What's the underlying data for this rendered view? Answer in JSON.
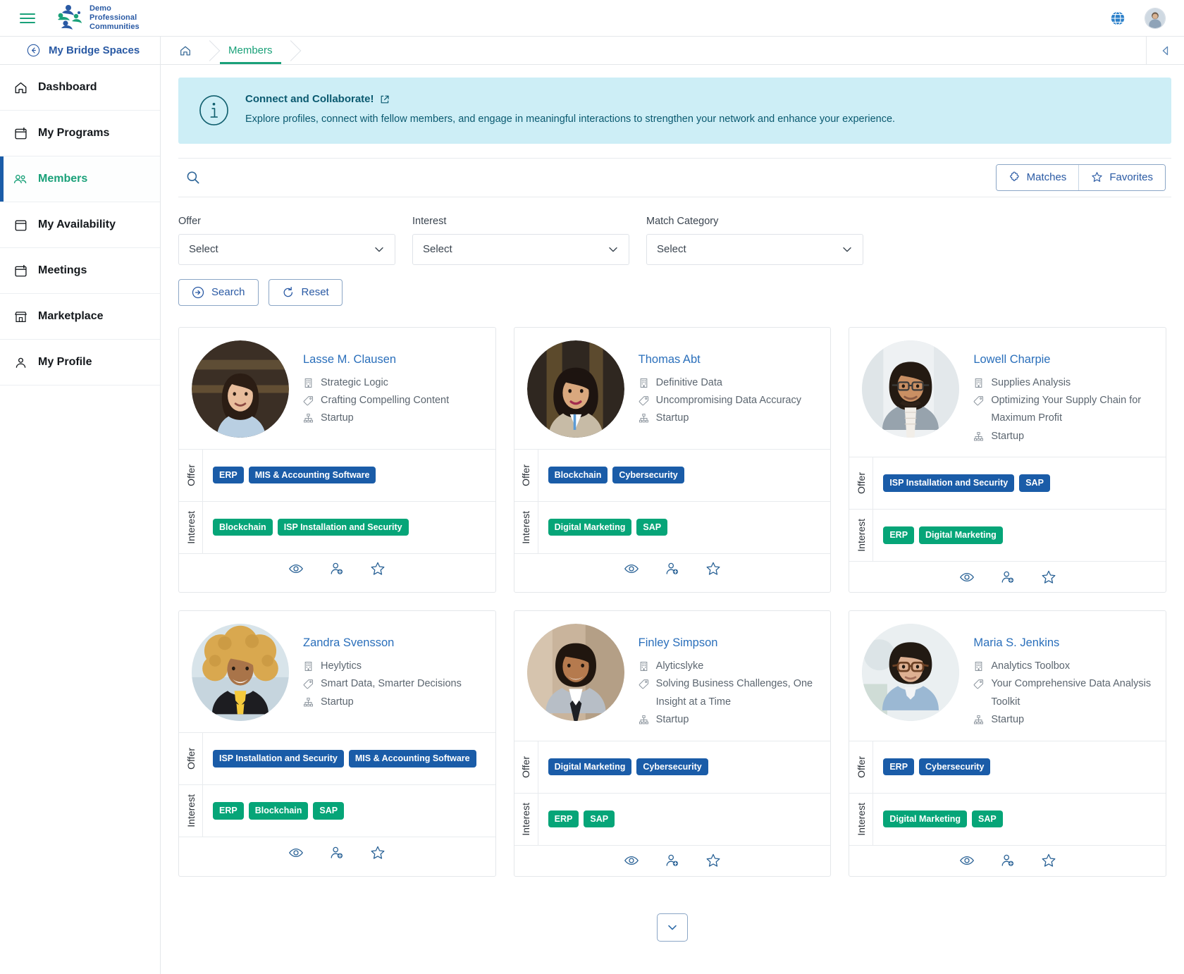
{
  "topbar": {
    "menu_icon": "hamburger-icon",
    "logo": {
      "line1": "Demo",
      "line2": "Professional",
      "line3": "Communities"
    },
    "globe_icon": "globe-icon",
    "avatar": "user-avatar"
  },
  "breadcrumb": {
    "back_label": "My Bridge Spaces",
    "home_icon": "home-icon",
    "items": [
      {
        "label": "Members",
        "active": true
      }
    ],
    "collapse_icon": "chevron-left-icon"
  },
  "sidebar": {
    "items": [
      {
        "label": "Dashboard",
        "icon": "home-icon",
        "active": false
      },
      {
        "label": "My Programs",
        "icon": "calendar-icon",
        "active": false
      },
      {
        "label": "Members",
        "icon": "people-icon",
        "active": true
      },
      {
        "label": "My Availability",
        "icon": "calendar-icon",
        "active": false
      },
      {
        "label": "Meetings",
        "icon": "calendar-icon",
        "active": false
      },
      {
        "label": "Marketplace",
        "icon": "store-icon",
        "active": false
      },
      {
        "label": "My Profile",
        "icon": "person-icon",
        "active": false
      }
    ]
  },
  "banner": {
    "icon": "info-icon",
    "title": "Connect and Collaborate!",
    "link_icon": "external-link-icon",
    "text": "Explore profiles, connect with fellow members, and engage in meaningful interactions to strengthen your network and enhance your experience."
  },
  "search": {
    "icon": "search-icon",
    "value": "",
    "placeholder": "",
    "matches_label": "Matches",
    "matches_icon": "puzzle-icon",
    "favorites_label": "Favorites",
    "favorites_icon": "star-icon"
  },
  "filters": [
    {
      "label": "Offer",
      "value": "Select"
    },
    {
      "label": "Interest",
      "value": "Select"
    },
    {
      "label": "Match Category",
      "value": "Select"
    }
  ],
  "actions": {
    "search_label": "Search",
    "search_icon": "arrow-right-circle-icon",
    "reset_label": "Reset",
    "reset_icon": "refresh-icon"
  },
  "card_labels": {
    "offer": "Offer",
    "interest": "Interest"
  },
  "card_action_icons": [
    "eye-icon",
    "add-person-icon",
    "star-icon"
  ],
  "members": [
    {
      "name": "Lasse M. Clausen",
      "company": "Strategic Logic",
      "tagline": "Crafting Compelling Content",
      "stage": "Startup",
      "offers": [
        "ERP",
        "MIS & Accounting Software"
      ],
      "interests": [
        "Blockchain",
        "ISP Installation and Security"
      ],
      "photo": "woman-long-dark-hair"
    },
    {
      "name": "Thomas Abt",
      "company": "Definitive Data",
      "tagline": "Uncompromising Data Accuracy",
      "stage": "Startup",
      "offers": [
        "Blockchain",
        "Cybersecurity"
      ],
      "interests": [
        "Digital Marketing",
        "SAP"
      ],
      "photo": "woman-wavy-hair-badge"
    },
    {
      "name": "Lowell Charpie",
      "company": "Supplies Analysis",
      "tagline": "Optimizing Your Supply Chain for Maximum Profit",
      "stage": "Startup",
      "offers": [
        "ISP Installation and Security",
        "SAP"
      ],
      "interests": [
        "ERP",
        "Digital Marketing"
      ],
      "photo": "man-glasses-grey-jacket"
    },
    {
      "name": "Zandra Svensson",
      "company": "Heylytics",
      "tagline": "Smart Data, Smarter Decisions",
      "stage": "Startup",
      "offers": [
        "ISP Installation and Security",
        "MIS & Accounting Software"
      ],
      "interests": [
        "ERP",
        "Blockchain",
        "SAP"
      ],
      "photo": "woman-curly-hair-yellow-top"
    },
    {
      "name": "Finley Simpson",
      "company": "Alyticslyke",
      "tagline": "Solving Business Challenges, One Insight at a Time",
      "stage": "Startup",
      "offers": [
        "Digital Marketing",
        "Cybersecurity"
      ],
      "interests": [
        "ERP",
        "SAP"
      ],
      "photo": "man-beard-suit-tie"
    },
    {
      "name": "Maria S. Jenkins",
      "company": "Analytics Toolbox",
      "tagline": "Your Comprehensive Data Analysis Toolkit",
      "stage": "Startup",
      "offers": [
        "ERP",
        "Cybersecurity"
      ],
      "interests": [
        "Digital Marketing",
        "SAP"
      ],
      "photo": "woman-glasses-blue-shirt"
    }
  ],
  "pagination": {
    "more_icon": "chevron-down-icon"
  },
  "colors": {
    "accent_green": "#1aa179",
    "accent_blue": "#2a5aa4",
    "tag_offer": "#1a5ca8",
    "tag_interest": "#06a578",
    "banner_bg": "#cdeef6",
    "banner_text": "#0b5a70"
  }
}
